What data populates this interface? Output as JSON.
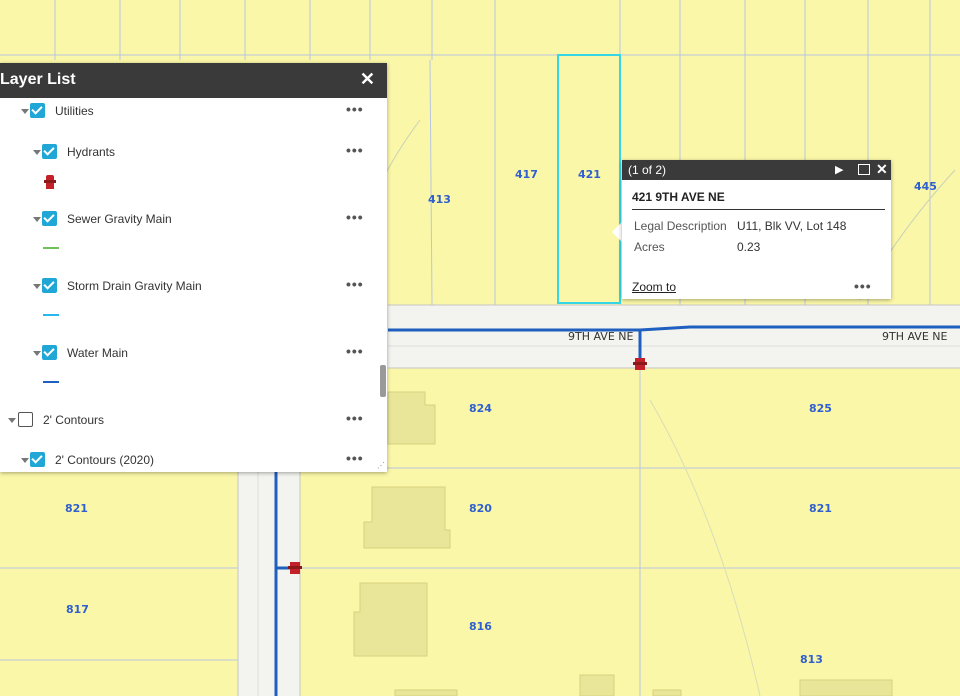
{
  "map": {
    "parcel_labels": [
      "417",
      "421",
      "413",
      "445",
      "824",
      "825",
      "821",
      "820",
      "821",
      "817",
      "816",
      "813"
    ],
    "street_labels": [
      "9TH AVE NE",
      "9TH AVE NE"
    ],
    "colors": {
      "parcel_fill": "#fbf7a8",
      "road": "#f2f2ee",
      "building": "#e9e69a",
      "water_main": "#1f5fbf",
      "selection": "#35d7e6"
    }
  },
  "layer_list": {
    "title": "Layer List",
    "close_icon": "close-icon",
    "layers": [
      {
        "label": "Utilities",
        "checked": true,
        "expanded": true
      },
      {
        "label": "Hydrants",
        "checked": true,
        "expanded": true,
        "legend": "hydrant-icon"
      },
      {
        "label": "Sewer Gravity Main",
        "checked": true,
        "expanded": true,
        "legend_color": "#70c05a"
      },
      {
        "label": "Storm Drain Gravity Main",
        "checked": true,
        "expanded": true,
        "legend_color": "#29b6e8"
      },
      {
        "label": "Water Main",
        "checked": true,
        "expanded": true,
        "legend_color": "#1f5fbf"
      },
      {
        "label": "2' Contours",
        "checked": false,
        "expanded": true
      },
      {
        "label": "2' Contours (2020)",
        "checked": true,
        "expanded": true
      }
    ],
    "menu_glyph": "•••"
  },
  "popup": {
    "count": "(1 of 2)",
    "title": "421 9TH AVE NE",
    "fields": [
      {
        "key": "Legal Description",
        "value": "U11, Blk VV, Lot 148"
      },
      {
        "key": "Acres",
        "value": "0.23"
      }
    ],
    "zoom_label": "Zoom to",
    "menu_glyph": "•••",
    "next_icon": "play-icon",
    "maximize_icon": "maximize-icon",
    "close_icon": "close-icon"
  }
}
